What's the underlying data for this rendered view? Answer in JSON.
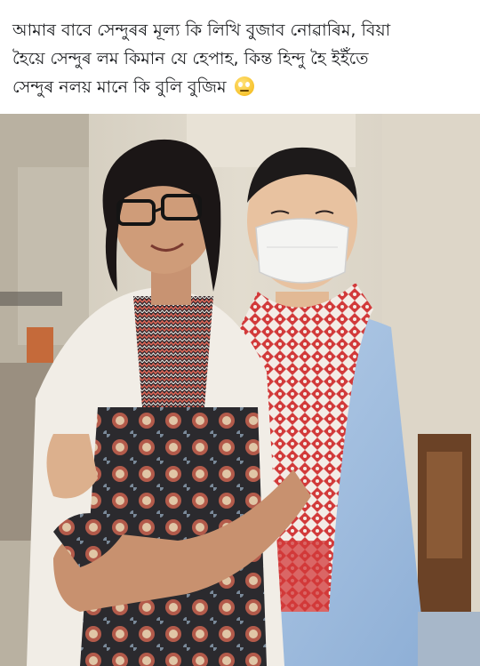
{
  "post": {
    "caption_lines": [
      "আমাৰ বাবে সেন্দুৰৰ মূল্য কি লিখি বুজাব নোৱাৰিম, বিয়া",
      "হৈয়ে সেন্দুৰ লম কিমান যে হেপাহ, কিন্ত হিন্দু হৈ ইইঁতে",
      "সেন্দুৰ নলয় মানে কি বুলি বুজিম"
    ],
    "caption_emoji": "rolling-eyes-emoji",
    "photo": {
      "description_icon": "photo"
    }
  },
  "colors": {
    "background": "#ffffff",
    "text": "#1c1e21",
    "gamosa_red": "#d23a3a",
    "shirt_blue": "#a9c4e4"
  }
}
